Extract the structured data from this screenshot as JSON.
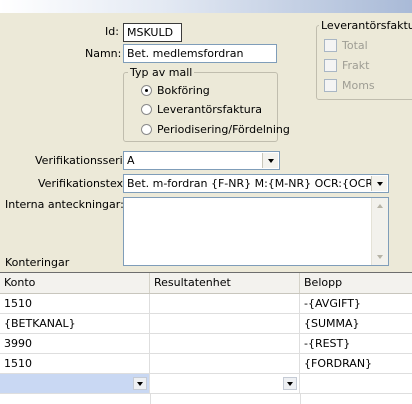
{
  "form": {
    "id_label": "Id:",
    "id_value": "MSKULD",
    "name_label": "Namn:",
    "name_value": "Bet. medlemsfordran",
    "template_type": {
      "legend": "Typ av mall",
      "options": [
        "Bokföring",
        "Leverantörsfaktura",
        "Periodisering/Fördelning"
      ],
      "selected": "Bokföring"
    },
    "supplier_invoice": {
      "legend": "Leverantörsfaktura",
      "checkboxes": [
        "Total",
        "Frakt",
        "Moms"
      ]
    },
    "verification_series_label": "Verifikationsserie:",
    "verification_series_value": "A",
    "verification_text_label": "Verifikationstext:",
    "verification_text_value": "Bet. m-fordran {F-NR} M:{M-NR} OCR:{OCR}",
    "internal_notes_label": "Interna anteckningar:",
    "internal_notes_value": "",
    "postings_label": "Konteringar"
  },
  "grid": {
    "columns": [
      "Konto",
      "Resultatenhet",
      "Belopp"
    ],
    "rows": [
      [
        "1510",
        "",
        "-{AVGIFT}"
      ],
      [
        "{BETKANAL}",
        "",
        "{SUMMA}"
      ],
      [
        "3990",
        "",
        "-{REST}"
      ],
      [
        "1510",
        "",
        "{FORDRAN}"
      ]
    ]
  }
}
